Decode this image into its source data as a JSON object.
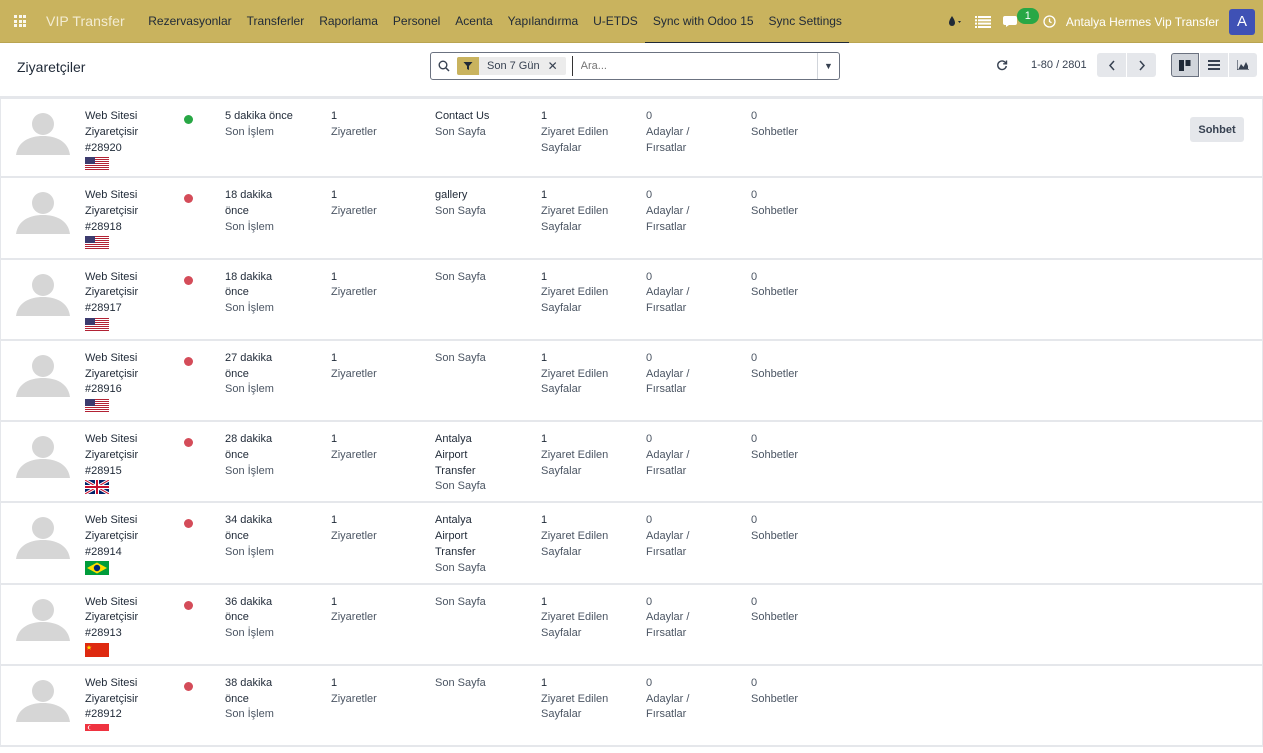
{
  "navbar": {
    "brand": "VIP Transfer",
    "menu": [
      "Rezervasyonlar",
      "Transferler",
      "Raporlama",
      "Personel",
      "Acenta",
      "Yapılandırma",
      "U-ETDS",
      "Sync with Odoo 15",
      "Sync Settings"
    ],
    "chat_count": "1",
    "company": "Antalya Hermes Vip Transfer",
    "user_initial": "A",
    "accent": "#c9b35e"
  },
  "control": {
    "breadcrumb": "Ziyaretçiler",
    "facet": "Son 7 Gün",
    "search_placeholder": "Ara...",
    "pager": "1-80 / 2801"
  },
  "labels": {
    "visitor_prefix_1": "Web Sitesi",
    "visitor_prefix_2": "Ziyaretçisir",
    "last_action": "Son İşlem",
    "visits": "Ziyaretler",
    "last_page": "Son Sayfa",
    "visited_1": "Ziyaret Edilen",
    "visited_2": "Sayfalar",
    "leads_1": "Adaylar /",
    "leads_2": "Fırsatlar",
    "chats": "Sohbetler",
    "chat_button": "Sohbet"
  },
  "visitors": [
    {
      "id": "#28920",
      "flag": "us",
      "status": "online",
      "time_1": "5 dakika önce",
      "time_2": "",
      "visits": "1",
      "page_lines": [
        "Contact Us"
      ],
      "pages": "1",
      "leads": "0",
      "chats": "0",
      "has_chat": true
    },
    {
      "id": "#28918",
      "flag": "us",
      "status": "offline",
      "time_1": "18 dakika",
      "time_2": "önce",
      "visits": "1",
      "page_lines": [
        "gallery"
      ],
      "pages": "1",
      "leads": "0",
      "chats": "0",
      "has_chat": false
    },
    {
      "id": "#28917",
      "flag": "us",
      "status": "offline",
      "time_1": "18 dakika",
      "time_2": "önce",
      "visits": "1",
      "page_lines": [],
      "pages": "1",
      "leads": "0",
      "chats": "0",
      "has_chat": false
    },
    {
      "id": "#28916",
      "flag": "us",
      "status": "offline",
      "time_1": "27 dakika",
      "time_2": "önce",
      "visits": "1",
      "page_lines": [],
      "pages": "1",
      "leads": "0",
      "chats": "0",
      "has_chat": false
    },
    {
      "id": "#28915",
      "flag": "gb",
      "status": "offline",
      "time_1": "28 dakika",
      "time_2": "önce",
      "visits": "1",
      "page_lines": [
        "Antalya",
        "Airport",
        "Transfer"
      ],
      "pages": "1",
      "leads": "0",
      "chats": "0",
      "has_chat": false
    },
    {
      "id": "#28914",
      "flag": "br",
      "status": "offline",
      "time_1": "34 dakika",
      "time_2": "önce",
      "visits": "1",
      "page_lines": [
        "Antalya",
        "Airport",
        "Transfer"
      ],
      "pages": "1",
      "leads": "0",
      "chats": "0",
      "has_chat": false
    },
    {
      "id": "#28913",
      "flag": "cn",
      "status": "offline",
      "time_1": "36 dakika",
      "time_2": "önce",
      "visits": "1",
      "page_lines": [],
      "pages": "1",
      "leads": "0",
      "chats": "0",
      "has_chat": false
    },
    {
      "id": "#28912",
      "flag": "sg",
      "status": "offline",
      "time_1": "38 dakika",
      "time_2": "önce",
      "visits": "1",
      "page_lines": [],
      "pages": "1",
      "leads": "0",
      "chats": "0",
      "has_chat": false
    }
  ],
  "colors": {
    "online": "#28a745",
    "offline": "#d44c59"
  }
}
